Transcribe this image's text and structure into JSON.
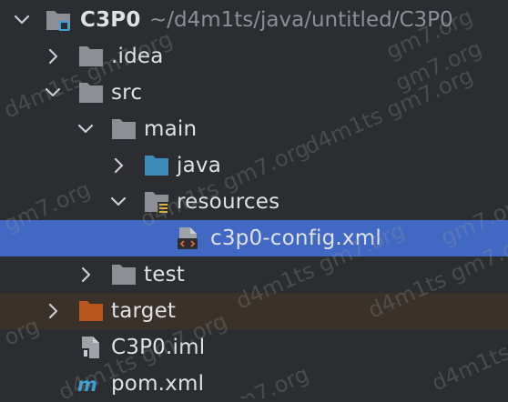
{
  "tree": {
    "root": {
      "name": "C3P0",
      "path": "~/d4m1ts/java/untitled/C3P0"
    },
    "idea": {
      "name": ".idea"
    },
    "src": {
      "name": "src"
    },
    "main": {
      "name": "main"
    },
    "java": {
      "name": "java"
    },
    "resources": {
      "name": "resources"
    },
    "config": {
      "name": "c3p0-config.xml"
    },
    "test": {
      "name": "test"
    },
    "target": {
      "name": "target"
    },
    "iml": {
      "name": "C3P0.iml"
    },
    "pom": {
      "name": "pom.xml"
    }
  },
  "colors": {
    "background": "#2b2d30",
    "selection": "#4169c4",
    "excluded": "#3a312a",
    "folder": "#8c9096",
    "source_folder": "#3d8bb8",
    "excluded_folder": "#b9561d"
  },
  "watermark": {
    "text_a": "d4m1ts gm7.org",
    "text_b": "gm7.org",
    "text_c": "d4m1ts",
    "text_d": "org"
  }
}
